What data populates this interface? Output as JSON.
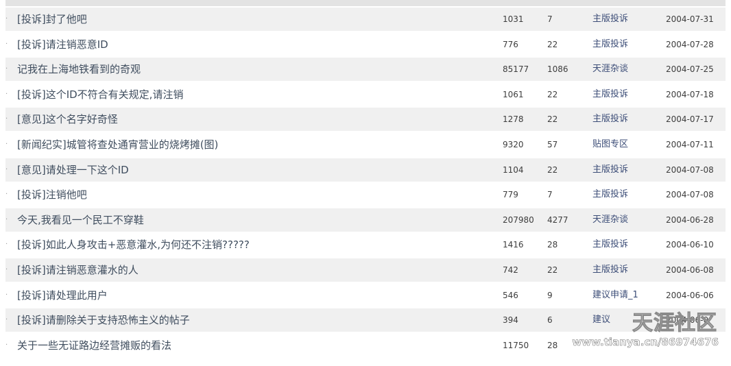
{
  "posts": [
    {
      "title": "[投诉]封了他吧",
      "views": "1031",
      "replies": "7",
      "board": "主版投诉",
      "date": "2004-07-31"
    },
    {
      "title": "[投诉]请注销恶意ID",
      "views": "776",
      "replies": "22",
      "board": "主版投诉",
      "date": "2004-07-28"
    },
    {
      "title": "记我在上海地铁看到的奇观",
      "views": "85177",
      "replies": "1086",
      "board": "天涯杂谈",
      "date": "2004-07-25"
    },
    {
      "title": "[投诉]这个ID不符合有关规定,请注销",
      "views": "1061",
      "replies": "22",
      "board": "主版投诉",
      "date": "2004-07-18"
    },
    {
      "title": "[意见]这个名字好奇怪",
      "views": "1278",
      "replies": "22",
      "board": "主版投诉",
      "date": "2004-07-17"
    },
    {
      "title": "[新闻纪实]城管将查处通宵营业的烧烤摊(图)",
      "views": "9320",
      "replies": "57",
      "board": "贴图专区",
      "date": "2004-07-11"
    },
    {
      "title": "[意见]请处理一下这个ID",
      "views": "1104",
      "replies": "22",
      "board": "主版投诉",
      "date": "2004-07-08"
    },
    {
      "title": "[投诉]注销他吧",
      "views": "779",
      "replies": "7",
      "board": "主版投诉",
      "date": "2004-07-08"
    },
    {
      "title": "今天,我看见一个民工不穿鞋",
      "views": "207980",
      "replies": "4277",
      "board": "天涯杂谈",
      "date": "2004-06-28"
    },
    {
      "title": "[投诉]如此人身攻击+恶意灌水,为何还不注销?????",
      "views": "1416",
      "replies": "28",
      "board": "主版投诉",
      "date": "2004-06-10"
    },
    {
      "title": "[投诉]请注销恶意灌水的人",
      "views": "742",
      "replies": "22",
      "board": "主版投诉",
      "date": "2004-06-08"
    },
    {
      "title": "[投诉]请处理此用户",
      "views": "546",
      "replies": "9",
      "board": "建议申请_1",
      "date": "2004-06-06"
    },
    {
      "title": "[投诉]请删除关于支持恐怖主义的帖子",
      "views": "394",
      "replies": "6",
      "board": "建议",
      "date": "2004-06-0"
    },
    {
      "title": "关于一些无证路边经营摊贩的看法",
      "views": "11750",
      "replies": "28",
      "board": "",
      "date": ""
    }
  ],
  "bullet_glyph": "·",
  "watermark": {
    "name": "天涯社区",
    "url": "www.tianya.cn/86974676"
  }
}
